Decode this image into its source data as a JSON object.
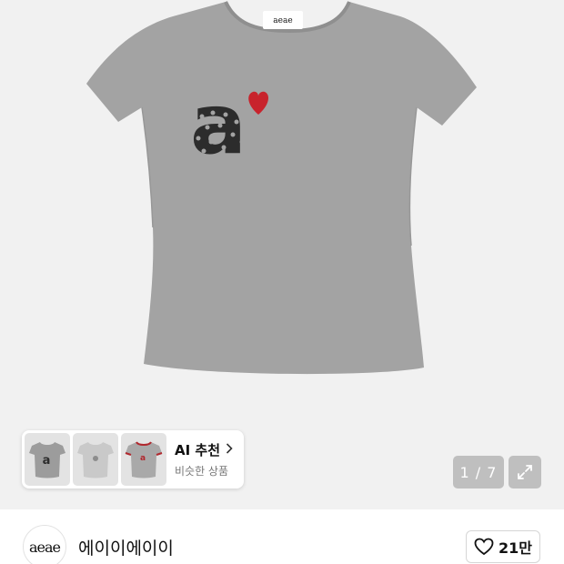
{
  "product": {
    "tag_label": "aeae",
    "print_letter": "a"
  },
  "ai_recommend": {
    "title": "AI 추천",
    "subtitle": "비슷한 상품",
    "thumb1_mark": "a",
    "thumb3_mark": "a"
  },
  "gallery": {
    "counter": "1 / 7"
  },
  "brand": {
    "logo_text": "aeae",
    "name": "에이이에이이"
  },
  "like": {
    "count": "21만"
  },
  "icons": {
    "chevron": "chevron-right-icon",
    "expand": "expand-icon",
    "heart": "heart-outline-icon"
  },
  "colors": {
    "shirt": "#a3a3a3",
    "print_black": "#2c2c2c",
    "heart_red": "#c8232c",
    "ringer_trim": "#b0282e"
  }
}
